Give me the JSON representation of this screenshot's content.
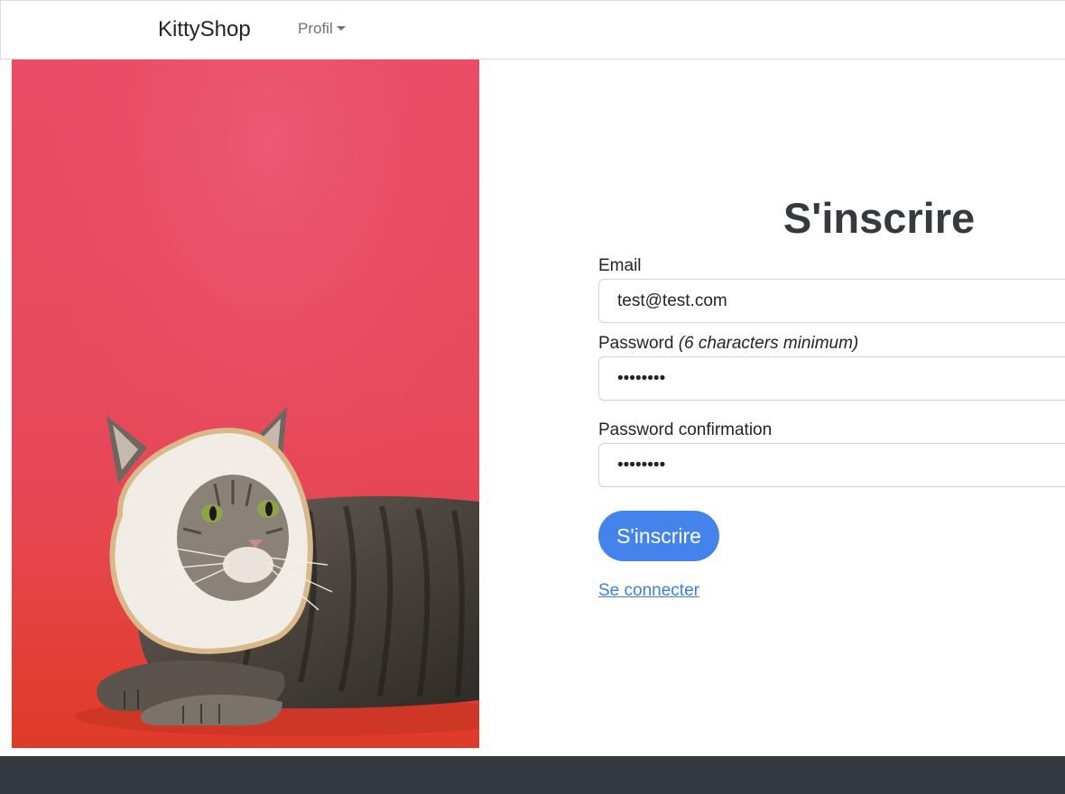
{
  "navbar": {
    "brand": "KittyShop",
    "profile_menu": "Profil"
  },
  "hero": {
    "image": "cat-with-bread-slice-on-head-photo"
  },
  "form": {
    "title": "S'inscrire",
    "email_label": "Email",
    "email_value": "test@test.com",
    "password_label": "Password",
    "password_hint": "(6 characters minimum)",
    "password_value": "password",
    "password_confirmation_label": "Password confirmation",
    "password_confirmation_value": "password",
    "submit_label": "S'inscrire",
    "login_link": "Se connecter"
  },
  "colors": {
    "primary_button": "#4583ec",
    "link": "#3b7ee6",
    "footer": "#343a40",
    "hero_background": "#e94c64"
  }
}
